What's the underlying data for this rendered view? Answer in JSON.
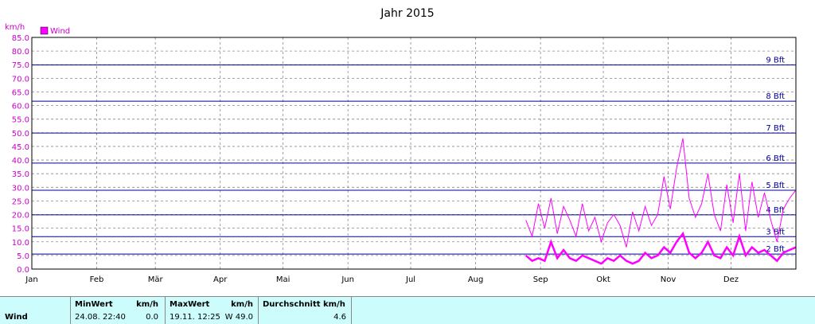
{
  "chart_data": {
    "type": "line",
    "title": "Jahr 2015",
    "ylabel": "km/h",
    "legend": [
      "Wind"
    ],
    "ylim": [
      0,
      85
    ],
    "y_ticks": [
      "0.0",
      "5.0",
      "10.0",
      "15.0",
      "20.0",
      "25.0",
      "30.0",
      "35.0",
      "40.0",
      "45.0",
      "50.0",
      "55.0",
      "60.0",
      "65.0",
      "70.0",
      "75.0",
      "80.0",
      "85.0"
    ],
    "x_ticks": [
      "Jan",
      "Feb",
      "Mär",
      "Apr",
      "Mai",
      "Jun",
      "Jul",
      "Aug",
      "Sep",
      "Okt",
      "Nov",
      "Dez"
    ],
    "beaufort": [
      {
        "label": "2 Bft",
        "value": 5.5
      },
      {
        "label": "3 Bft",
        "value": 11.9
      },
      {
        "label": "4 Bft",
        "value": 19.9
      },
      {
        "label": "5 Bft",
        "value": 28.9
      },
      {
        "label": "6 Bft",
        "value": 38.9
      },
      {
        "label": "7 Bft",
        "value": 49.9
      },
      {
        "label": "8 Bft",
        "value": 61.6
      },
      {
        "label": "9 Bft",
        "value": 74.9
      }
    ],
    "series": [
      {
        "name": "Wind",
        "color": "#ff00ff",
        "x": [
          236,
          239,
          242,
          245,
          248,
          251,
          254,
          257,
          260,
          263,
          266,
          269,
          272,
          275,
          278,
          281,
          284,
          287,
          290,
          293,
          296,
          299,
          302,
          305,
          308,
          311,
          314,
          317,
          320,
          323,
          326,
          329,
          332,
          335,
          338,
          341,
          344,
          347,
          350,
          353,
          356,
          359,
          362,
          365
        ],
        "max": [
          18,
          12,
          24,
          15,
          26,
          13,
          23,
          18,
          12,
          24,
          14,
          19,
          10,
          17,
          20,
          16,
          8,
          21,
          14,
          23,
          16,
          20,
          34,
          22,
          37,
          48,
          26,
          19,
          24,
          35,
          20,
          14,
          31,
          17,
          35,
          14,
          32,
          19,
          28,
          18,
          10,
          22,
          26,
          29
        ],
        "avg": [
          5,
          3,
          4,
          3,
          10,
          4,
          7,
          4,
          3,
          5,
          4,
          3,
          2,
          4,
          3,
          5,
          3,
          2,
          3,
          6,
          4,
          5,
          8,
          6,
          10,
          13,
          6,
          4,
          6,
          10,
          5,
          4,
          8,
          5,
          12,
          5,
          8,
          6,
          7,
          5,
          3,
          6,
          7,
          8
        ]
      }
    ]
  },
  "stats": {
    "row_label": "Wind",
    "min_header": "MinWert",
    "min_unit": "km/h",
    "min_time": "24.08.  22:40",
    "min_value": "0.0",
    "max_header": "MaxWert",
    "max_unit": "km/h",
    "max_time": "19.11.  12:25",
    "max_value": "W 49.0",
    "avg_header": "Durchschnitt km/h",
    "avg_value": "4.6"
  }
}
